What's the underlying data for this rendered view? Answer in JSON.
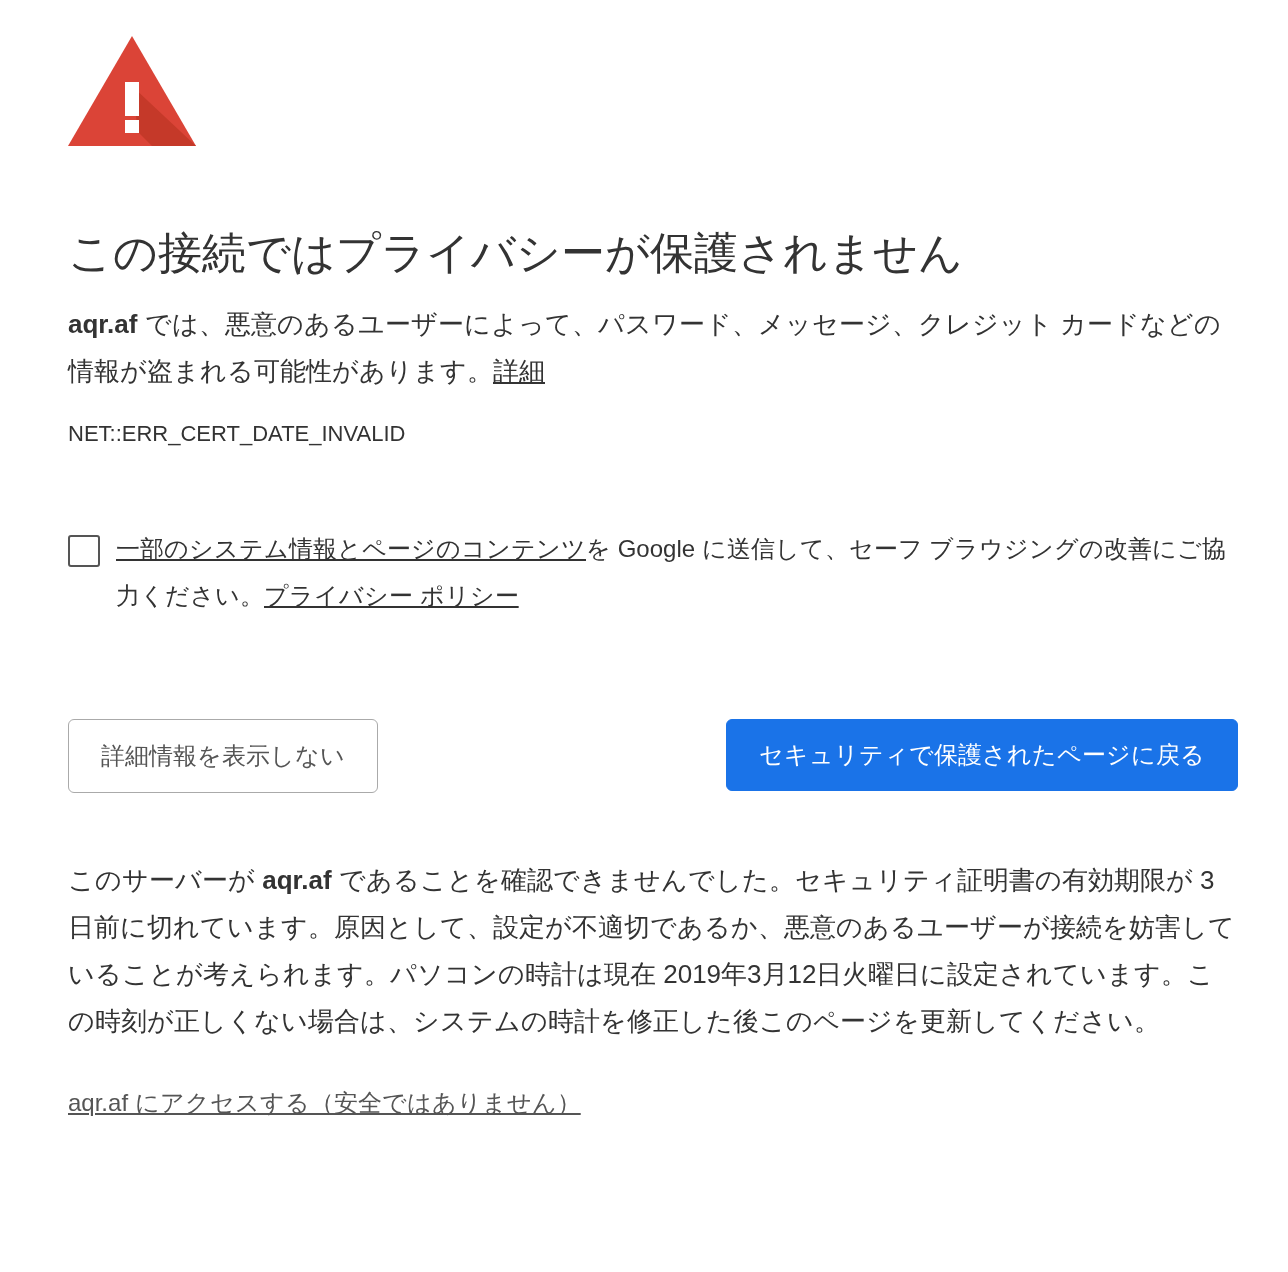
{
  "heading": "この接続ではプライバシーが保護されません",
  "intro": {
    "text": "**aqr.af** では、悪意のあるユーザーによって、パスワード、メッセージ、クレジット カードなどの情報が盗まれる可能性があります。",
    "link": "詳細"
  },
  "error_code": "NET::ERR_CERT_DATE_INVALID",
  "consent": {
    "checked": false,
    "link": "一部のシステム情報とページのコンテンツ",
    "text": "を Google に送信して、セーフ ブラウジングの改善にご協力ください。",
    "policy_link": "プライバシー ポリシー"
  },
  "buttons": [
    {
      "label": "詳細情報を表示しない",
      "kind": "secondary"
    },
    {
      "label": "セキュリティで保護されたページに戻る",
      "kind": "primary"
    }
  ],
  "details": "このサーバーが **aqr.af** であることを確認できませんでした。セキュリティ証明書の有効期限が 3 日前に切れています。原因として、設定が不適切であるか、悪意のあるユーザーが接続を妨害していることが考えられます。パソコンの時計は現在 2019年3月12日火曜日に設定されています。この時刻が正しくない場合は、システムの時計を修正した後このページを更新してください。",
  "proceed_link": "aqr.af にアクセスする（安全ではありません）"
}
